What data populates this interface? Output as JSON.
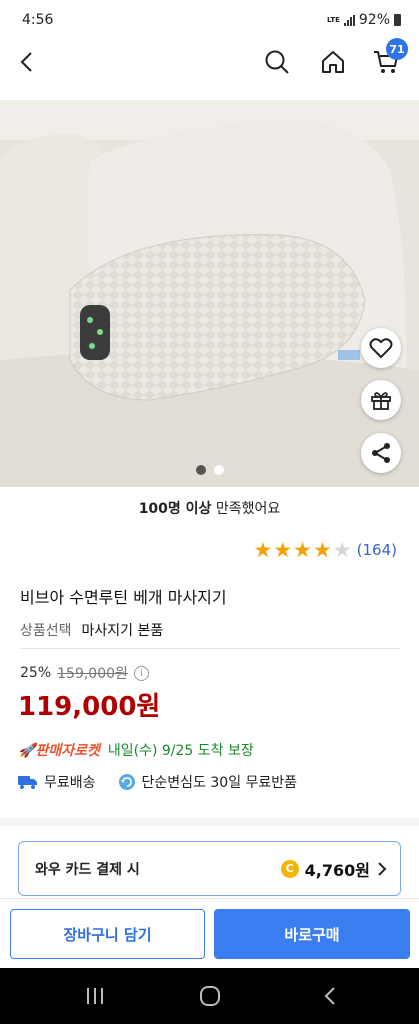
{
  "status_bar": {
    "time": "4:56",
    "network": "LTE",
    "battery": "92%"
  },
  "header": {
    "cart_count": "71"
  },
  "gallery": {
    "page_index": 1,
    "page_count": 2
  },
  "satisfaction": {
    "bold": "100명 이상",
    "rest": " 만족했어요"
  },
  "rating": {
    "value": 4,
    "max": 5,
    "count": "(164)"
  },
  "product": {
    "title": "비브아 수면루틴 베개 마사지기",
    "option_label": "상품선택",
    "option_value": "마사지기 본품",
    "discount": "25%",
    "original_price": "159,000원",
    "price": "119,000원"
  },
  "delivery": {
    "rocket_label": "판매자로켓",
    "arrival": "내일(수) 9/25 도착 보장",
    "free_shipping": "무료배송",
    "free_return": "단순변심도 30일 무료반품"
  },
  "card_benefit": {
    "label": "와우 카드 결제 시",
    "amount": "4,760원",
    "coin_symbol": "C"
  },
  "actions": {
    "cart_label": "장바구니 담기",
    "buy_label": "바로구매"
  },
  "colors": {
    "accent": "#3b7ef1",
    "price": "#ae0000",
    "rocket": "#e8542e",
    "delivery": "#1a8a2b",
    "star": "#f5a100"
  },
  "icons": [
    "back-icon",
    "search-icon",
    "home-icon",
    "cart-icon",
    "heart-icon",
    "gift-icon",
    "share-icon",
    "info-icon",
    "truck-icon",
    "return-icon",
    "chevron-right-icon",
    "recents-icon",
    "home-circle-icon",
    "system-back-icon"
  ]
}
